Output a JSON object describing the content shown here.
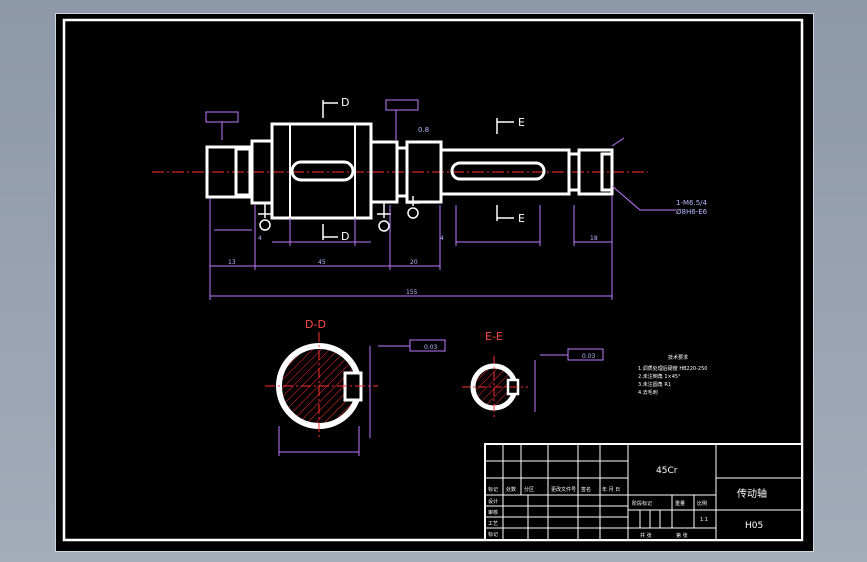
{
  "drawing": {
    "section_d_label": "D-D",
    "section_e_label": "E-E",
    "cut_d_top": "D",
    "cut_d_bottom": "D",
    "cut_e_top": "E",
    "cut_e_bottom": "E",
    "thread_callout_line1": "1-M6.5/4",
    "thread_callout_line2": "Ø8H6-E6",
    "surface_finish_note": "0.8",
    "tolerance_box_1": "0.03",
    "tolerance_box_2": "0.03",
    "dim_overall": "155",
    "dim_seg_1": "13",
    "dim_seg_2": "45",
    "dim_seg_3": "20",
    "dim_small_1": "4",
    "dim_small_2": "4",
    "dim_small_3": "18"
  },
  "technical_requirements": {
    "title": "技术要求",
    "lines": [
      "1.调质处理后硬度 HB220-250",
      "2.未注倒角 1×45°",
      "3.未注圆角 R1",
      "4.去毛刺"
    ]
  },
  "title_block": {
    "material": "45Cr",
    "part_name": "传动轴",
    "drawing_number": "H05",
    "row_labels": [
      "设计",
      "审核",
      "工艺",
      "标记"
    ],
    "header_cells": [
      "标记",
      "处数",
      "分区",
      "更改文件号",
      "签名",
      "年 月 日"
    ],
    "stage_label": "阶段标记",
    "weight_label": "重量",
    "scale_label": "比例",
    "scale_value": "1:1",
    "sheet_info": [
      "共 张",
      "第 张"
    ]
  }
}
